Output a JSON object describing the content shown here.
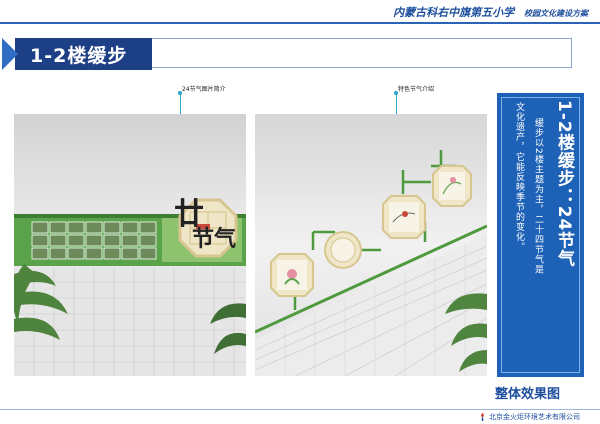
{
  "header": {
    "school": "内蒙古科右中旗第五小学",
    "plan": "校园文化建设方案"
  },
  "section": {
    "title": "1-2楼缓步"
  },
  "left_panel": {
    "label": "24节气图片简介",
    "sign_text": "节气"
  },
  "right_panel": {
    "label": "特色节气介绍"
  },
  "info": {
    "title": "1-2楼缓步：24节气",
    "line1": "缓步以2楼主题为主，二十四节气是",
    "line2": "文化遗产，它能反映季节的变化。",
    "effect": "整体效果图"
  },
  "footer": {
    "company": "北京金火炬环境艺术有限公司"
  },
  "colors": {
    "brand_blue": "#1e62b7",
    "dark_blue": "#1c3f86",
    "leaf_green": "#5aa34a",
    "frame_cream": "#efe6c8"
  }
}
